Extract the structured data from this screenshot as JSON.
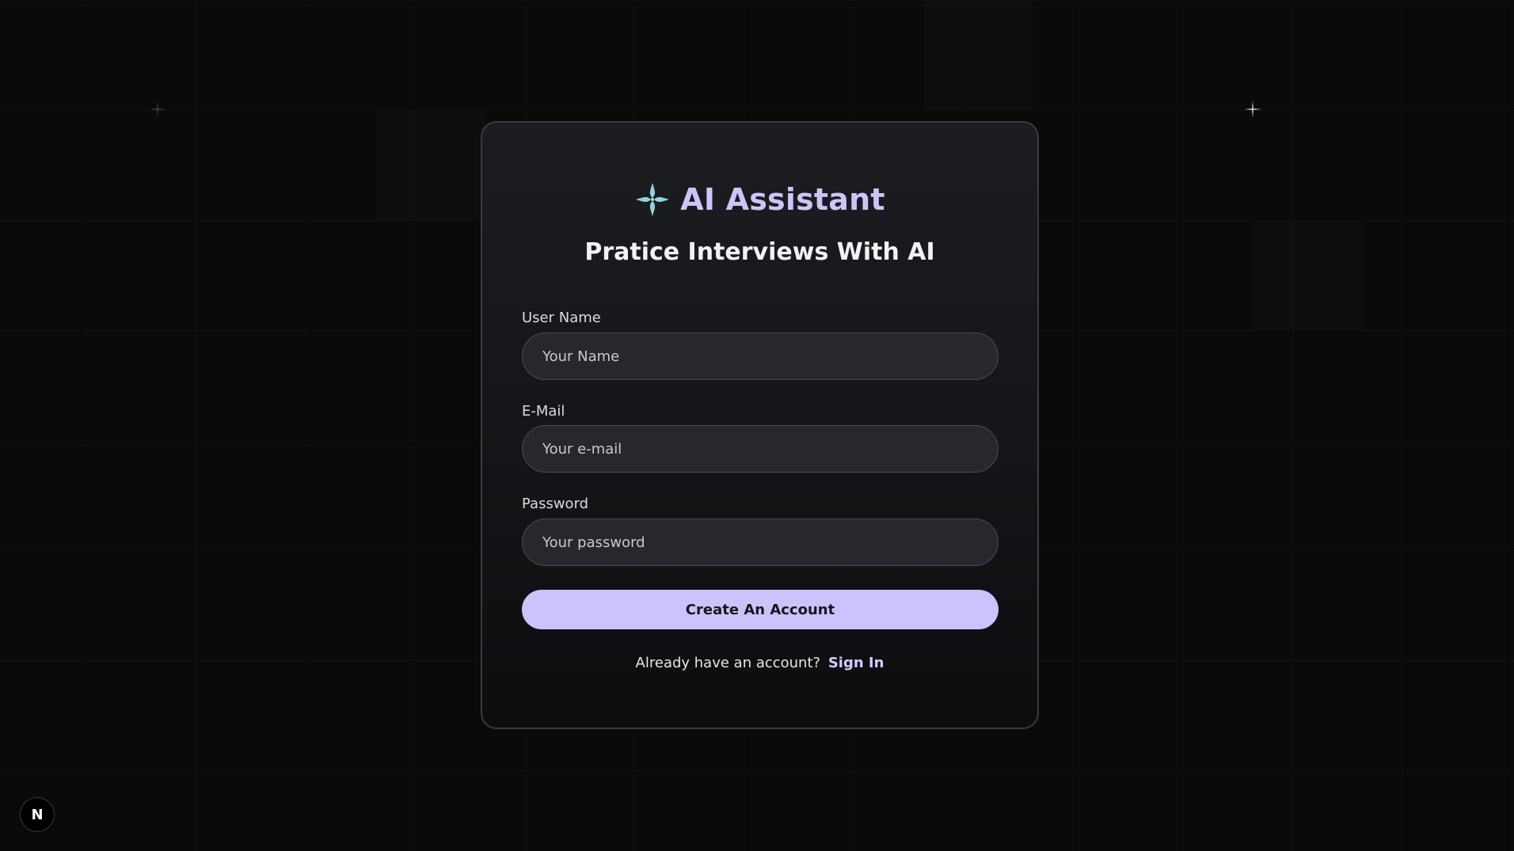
{
  "brand": {
    "title": "AI Assistant",
    "logo_icon": "four-petal-star-icon",
    "logo_color": "#8fd3e0"
  },
  "subtitle": "Pratice Interviews With AI",
  "form": {
    "username": {
      "label": "User Name",
      "placeholder": "Your Name",
      "value": ""
    },
    "email": {
      "label": "E-Mail",
      "placeholder": "Your e-mail",
      "value": ""
    },
    "password": {
      "label": "Password",
      "placeholder": "Your password",
      "value": ""
    },
    "submit_label": "Create An Account"
  },
  "signin": {
    "prompt": "Already have an account?",
    "link_label": "Sign In"
  },
  "dev_badge": {
    "letter": "N",
    "icon": "nextjs-icon"
  },
  "colors": {
    "accent": "#cbc3fb",
    "background": "#0a0a0b",
    "card_border": "#3a3b3f"
  }
}
